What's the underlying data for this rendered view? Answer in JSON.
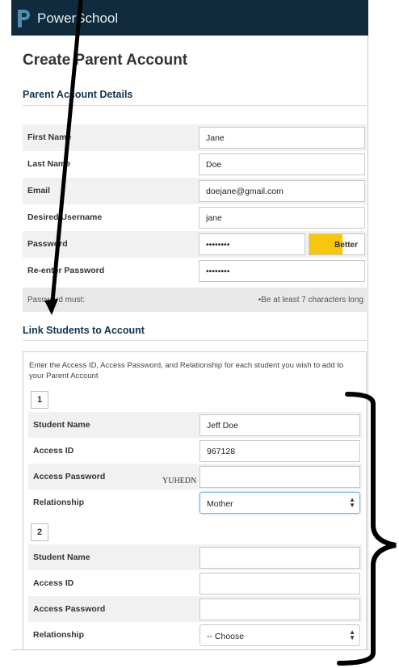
{
  "header": {
    "brand": "PowerSchool",
    "logo_icon": "powerschool-p-logo-icon"
  },
  "page_title": "Create Parent Account",
  "parent_section": {
    "heading": "Parent Account Details",
    "fields": [
      {
        "label": "First Name",
        "value": "Jane"
      },
      {
        "label": "Last Name",
        "value": "Doe"
      },
      {
        "label": "Email",
        "value": "doejane@gmail.com"
      },
      {
        "label": "Desired Username",
        "value": "jane"
      },
      {
        "label": "Password",
        "value": "••••••••",
        "strength": "Better",
        "strength_level": 0.6
      },
      {
        "label": "Re-enter Password",
        "value": "••••••••"
      }
    ],
    "password_note": {
      "label": "Password must:",
      "rule": "•Be at least 7 characters long"
    }
  },
  "students_section": {
    "heading": "Link Students to Account",
    "intro": "Enter the Access ID, Access Password, and Relationship for each student you wish to add to your Parent Account",
    "students": [
      {
        "number": "1",
        "name_label": "Student Name",
        "name": "Jeff Doe",
        "id_label": "Access ID",
        "access_id": "967128",
        "pw_label": "Access Password",
        "access_password": "",
        "rel_label": "Relationship",
        "relationship": "Mother"
      },
      {
        "number": "2",
        "name_label": "Student Name",
        "name": "",
        "id_label": "Access ID",
        "access_id": "",
        "pw_label": "Access Password",
        "access_password": "",
        "rel_label": "Relationship",
        "relationship": "-- Choose"
      }
    ],
    "stamp_text": "YUHEDN"
  },
  "colors": {
    "header_bg": "#0f2b3d",
    "logo": "#4d8fb0",
    "heading": "#15344f",
    "strength_fill": "#f7c60f"
  }
}
